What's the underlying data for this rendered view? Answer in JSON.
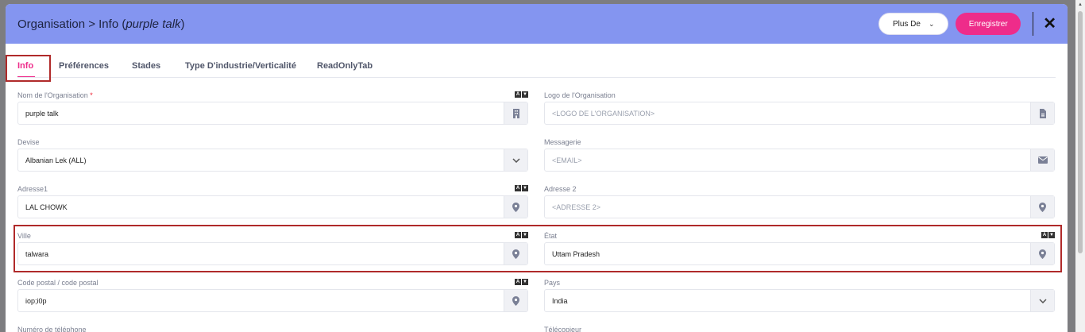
{
  "header": {
    "title_prefix": "Organisation > Info (",
    "title_name": "purple talk",
    "title_suffix": ")",
    "plus_de_label": "Plus De",
    "save_label": "Enregistrer",
    "close_symbol": "✕"
  },
  "tabs": [
    {
      "label": "Info",
      "active": true
    },
    {
      "label": "Préférences"
    },
    {
      "label": "Stades"
    },
    {
      "label": "Type D'industrie/Verticalité"
    },
    {
      "label": "ReadOnlyTab"
    }
  ],
  "form": {
    "org_name": {
      "label": "Nom de l'Organisation",
      "required_mark": "*",
      "value": "purple talk",
      "icon": "building-icon"
    },
    "org_logo": {
      "label": "Logo de l'Organisation",
      "placeholder": "<LOGO DE L'ORGANISATION>",
      "icon": "file-icon"
    },
    "currency": {
      "label": "Devise",
      "value": "Albanian Lek (ALL)",
      "icon": "chevron-down-icon"
    },
    "email": {
      "label": "Messagerie",
      "placeholder": "<EMAIL>",
      "icon": "envelope-icon"
    },
    "address1": {
      "label": "Adresse1",
      "value": "LAL CHOWK",
      "icon": "location-pin-icon"
    },
    "address2": {
      "label": "Adresse 2",
      "placeholder": "<ADRESSE 2>",
      "icon": "location-pin-icon"
    },
    "city": {
      "label": "Ville",
      "value": "talwara",
      "icon": "location-pin-icon"
    },
    "state": {
      "label": "État",
      "value": "Uttam Pradesh",
      "icon": "location-pin-icon"
    },
    "postal_code": {
      "label": "Code postal / code postal",
      "value": "iop;i0p",
      "icon": "location-pin-icon"
    },
    "country": {
      "label": "Pays",
      "value": "India",
      "icon": "chevron-down-icon"
    },
    "phone": {
      "label": "Numéro de téléphone"
    },
    "fax": {
      "label": "Télécopieur"
    }
  },
  "toggle_glyphs": {
    "a": "A",
    "b": "▼"
  },
  "colors": {
    "header_bg": "#8495f0",
    "accent": "#ee2c8a",
    "highlight": "#b02a2a"
  }
}
